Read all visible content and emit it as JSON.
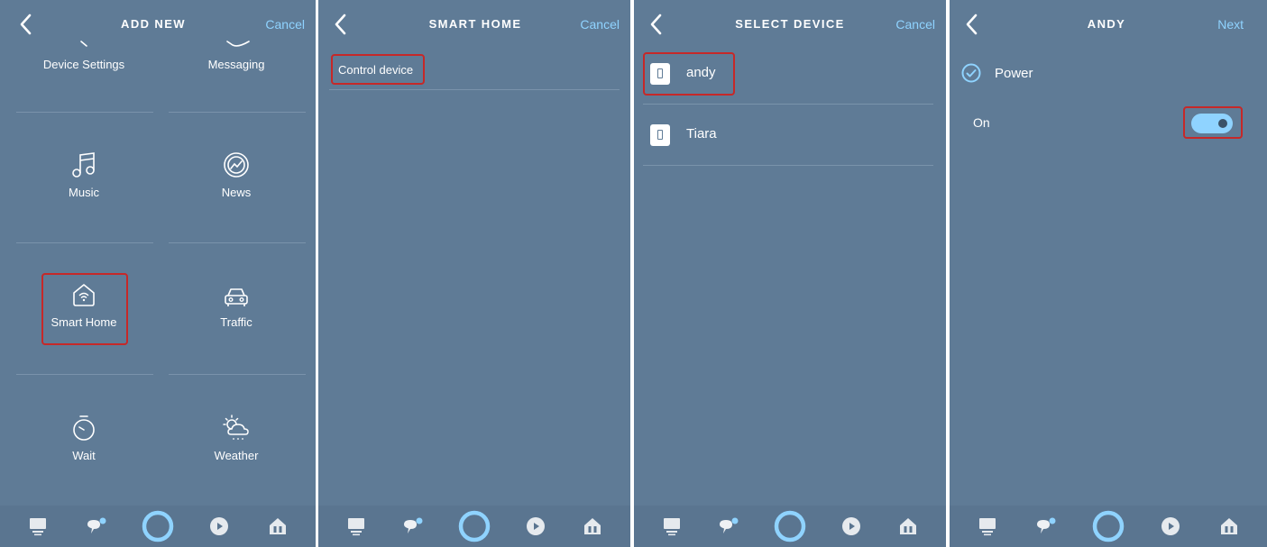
{
  "colors": {
    "panel_bg": "#5f7b96",
    "accent": "#8fd3ff",
    "highlight": "#c62828",
    "divider": "#7a93ab"
  },
  "add_new": {
    "title": "ADD NEW",
    "cancel_label": "Cancel",
    "tiles": [
      {
        "label": "Device Settings",
        "icon": "device-settings-icon"
      },
      {
        "label": "Messaging",
        "icon": "messaging-icon"
      },
      {
        "label": "Music",
        "icon": "music-note-icon"
      },
      {
        "label": "News",
        "icon": "news-icon"
      },
      {
        "label": "Smart Home",
        "icon": "smart-home-icon"
      },
      {
        "label": "Traffic",
        "icon": "car-icon"
      },
      {
        "label": "Wait",
        "icon": "timer-icon"
      },
      {
        "label": "Weather",
        "icon": "weather-icon"
      }
    ]
  },
  "smart_home": {
    "title": "SMART HOME",
    "cancel_label": "Cancel",
    "option_label": "Control device"
  },
  "select_device": {
    "title": "SELECT DEVICE",
    "cancel_label": "Cancel",
    "devices": [
      {
        "name": "andy",
        "icon": "switch-icon"
      },
      {
        "name": "Tiara",
        "icon": "switch-icon"
      }
    ]
  },
  "andy": {
    "title": "ANDY",
    "next_label": "Next",
    "power_label": "Power",
    "on_label": "On",
    "power_on": true
  },
  "footer_icons": [
    "home-icon",
    "communicate-icon",
    "alexa-icon",
    "play-icon",
    "devices-icon"
  ]
}
